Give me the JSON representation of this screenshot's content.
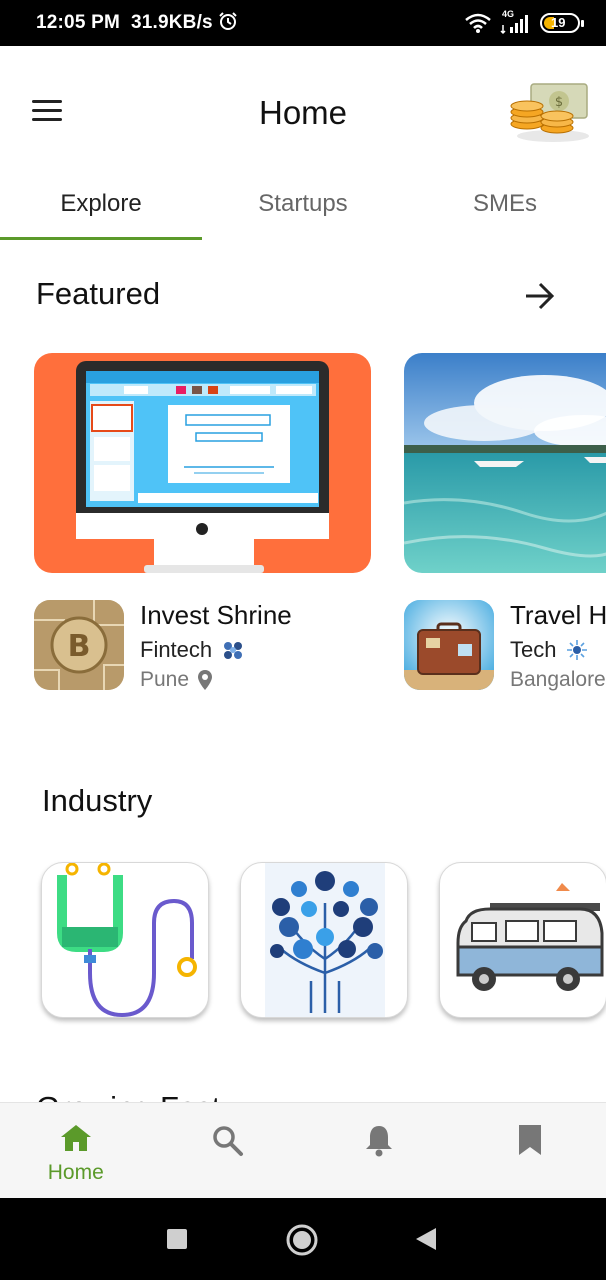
{
  "status": {
    "time": "12:05 PM",
    "speed": "31.9KB/s",
    "network": "4G",
    "battery": "19"
  },
  "header": {
    "title": "Home",
    "menu_icon": "hamburger-menu-icon",
    "coins_icon": "coins-money-icon"
  },
  "tabs": [
    {
      "label": "Explore",
      "active": true
    },
    {
      "label": "Startups",
      "active": false
    },
    {
      "label": "SMEs",
      "active": false
    }
  ],
  "featured": {
    "title": "Featured",
    "items": [
      {
        "name": "Invest Shrine",
        "category": "Fintech",
        "location": "Pune"
      },
      {
        "name": "Travel H",
        "category": "Tech",
        "location": "Bangalore"
      }
    ]
  },
  "industry": {
    "title": "Industry",
    "items": [
      "healthcare-stethoscope-icon",
      "technology-tree-icon",
      "travel-van-icon"
    ]
  },
  "next_section": {
    "title": "Growing Fast"
  },
  "bottom_nav": {
    "items": [
      {
        "label": "Home",
        "icon": "home-icon",
        "active": true
      },
      {
        "label": "",
        "icon": "search-icon",
        "active": false
      },
      {
        "label": "",
        "icon": "bell-icon",
        "active": false
      },
      {
        "label": "",
        "icon": "bookmark-icon",
        "active": false
      }
    ]
  },
  "colors": {
    "accent": "#5b9a2a",
    "card_orange": "#ff6f3c"
  }
}
